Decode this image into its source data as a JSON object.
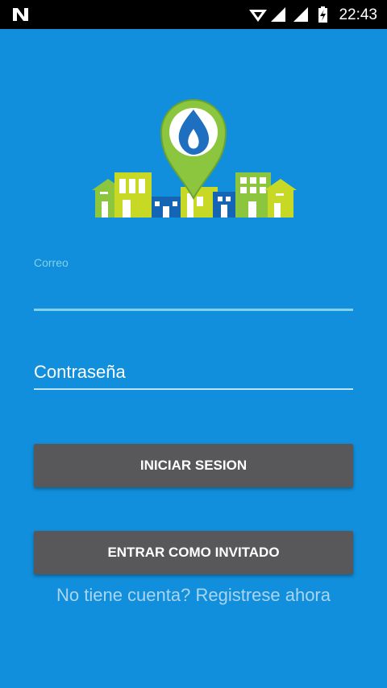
{
  "status_bar": {
    "time": "22:43",
    "icons": [
      "n-logo-icon",
      "wifi-icon",
      "signal-icon",
      "signal-icon",
      "battery-charging-icon"
    ]
  },
  "logo": {
    "icon": "gas-flame-map-pin-icon",
    "colors": {
      "green": "#8cc63f",
      "lime": "#c7d925",
      "blue": "#1565b5",
      "white": "#ffffff"
    }
  },
  "login": {
    "email_label": "Correo",
    "email_value": "",
    "password_placeholder": "Contraseña",
    "login_button": "INICIAR SESION",
    "guest_button": "ENTRAR COMO INVITADO",
    "register_link": "No tiene cuenta? Registrese ahora"
  },
  "colors": {
    "background": "#118fdc",
    "button": "#58585a",
    "accent": "#7fd2e8",
    "link": "#a9d5ee"
  }
}
